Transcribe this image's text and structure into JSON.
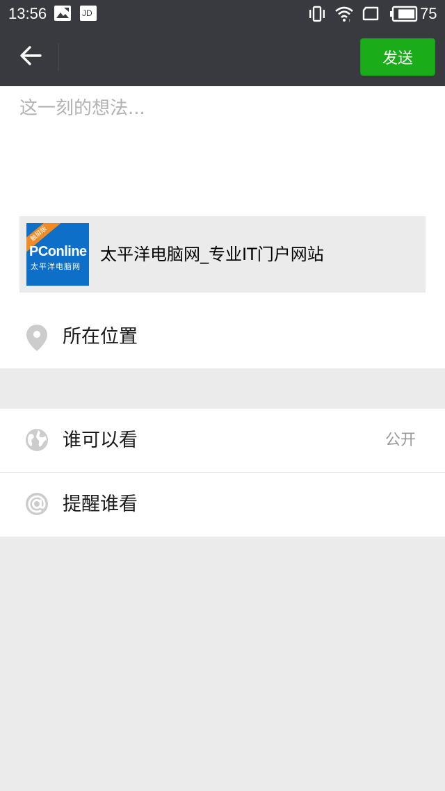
{
  "status_bar": {
    "time": "13:56",
    "battery_level": "75",
    "icons": [
      "photo-notification-icon",
      "jd-notification-icon",
      "vibrate-icon",
      "wifi-icon",
      "screen-rotate-icon",
      "battery-icon"
    ],
    "jd_label": "JD"
  },
  "header": {
    "send_label": "发送"
  },
  "compose": {
    "placeholder": "这一刻的想法...",
    "value": ""
  },
  "link_card": {
    "title": "太平洋电脑网_专业IT门户网站",
    "thumb_logo": "PConline",
    "thumb_sub": "太平洋电脑网",
    "thumb_ribbon": "触屏版"
  },
  "location": {
    "label": "所在位置"
  },
  "visibility": {
    "label": "谁可以看",
    "value": "公开"
  },
  "mention": {
    "label": "提醒谁看"
  },
  "colors": {
    "header_bg": "#393a3f",
    "send_button_bg": "#1aad19",
    "page_bg": "#ebebeb",
    "icon_gray": "#cccccc"
  }
}
